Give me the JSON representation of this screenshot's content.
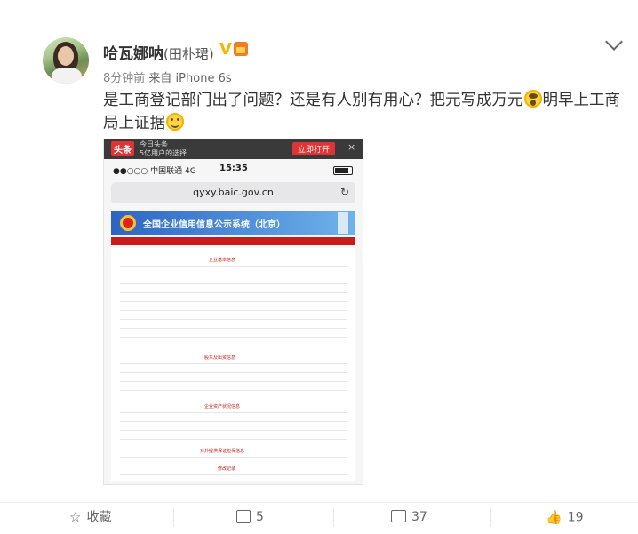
{
  "post": {
    "author_name": "哈瓦娜呐",
    "author_alias": "(田朴珺)",
    "verified_mark": "V",
    "time": "8分钟前",
    "source": "来自 iPhone 6s",
    "text_part1": "是工商登记部门出了问题？还是有人别有用心？把元写成万元",
    "text_part2": "明早上工商局上证据",
    "emoji_1": "scream-emoji",
    "emoji_2": "smile-emoji"
  },
  "screenshot": {
    "ad_logo": "头条",
    "ad_line1": "今日头条",
    "ad_line2": "5亿用户的选择",
    "ad_open": "立即打开",
    "ad_close": "×",
    "carrier": "●●○○○ 中国联通  4G",
    "phone_time": "15:35",
    "url": "qyxy.baic.gov.cn",
    "reload_icon": "↻",
    "site_title": "全国企业信用信息公示系统（北京）",
    "doc_heading_1": "企业基本信息",
    "doc_heading_2": "股东及出资信息",
    "doc_heading_3": "企业资产状况信息",
    "doc_heading_4": "对外提供保证担保信息",
    "doc_heading_5": "修改记录"
  },
  "toolbar": {
    "favorite_label": "收藏",
    "repost_count": "5",
    "comment_count": "37",
    "like_count": "19"
  },
  "colors": {
    "accent_red": "#c81c1c",
    "verified_gold": "#f7b500",
    "banner_blue": "#2b64c4"
  }
}
